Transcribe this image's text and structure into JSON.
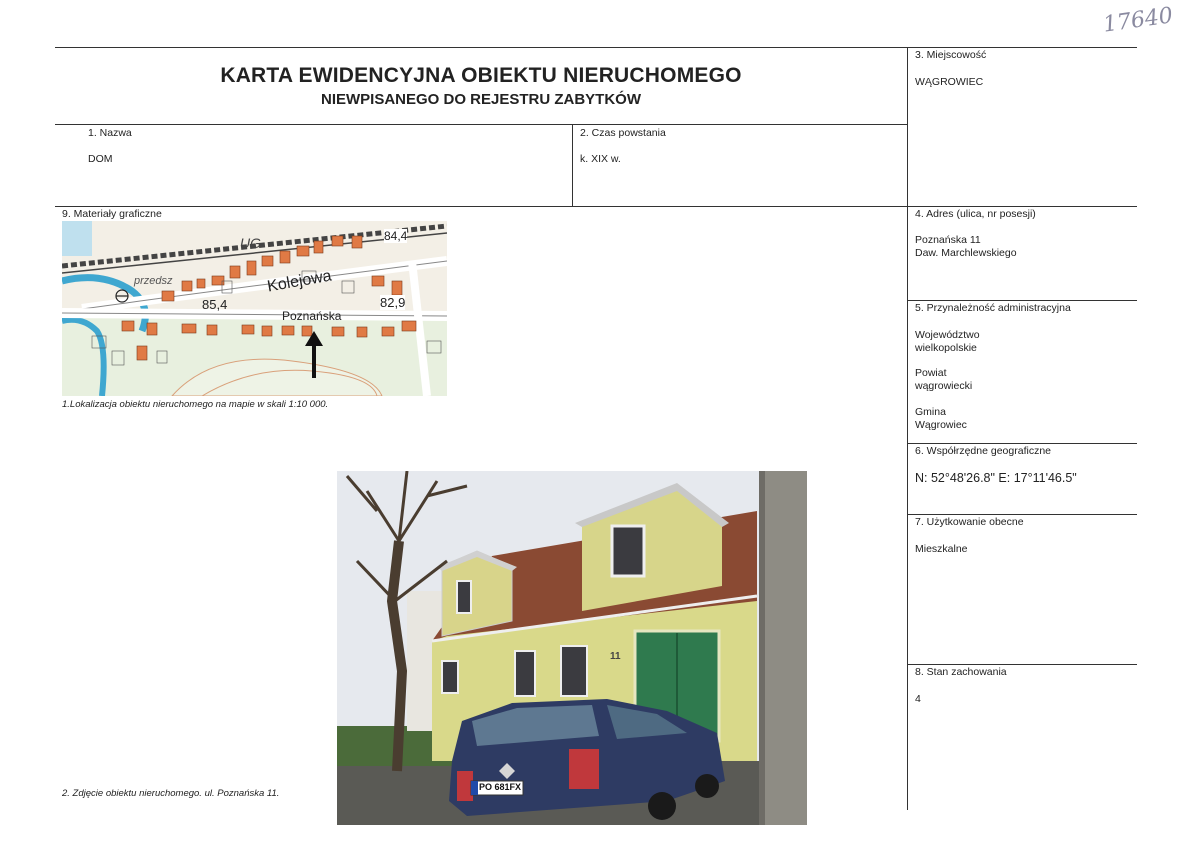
{
  "header": {
    "handwritten_number": "17640",
    "title": "KARTA EWIDENCYJNA OBIEKTU NIERUCHOMEGO",
    "subtitle": "NIEWPISANEGO DO REJESTRU ZABYTKÓW"
  },
  "fields": {
    "nazwa": {
      "label": "1.    Nazwa",
      "value": "DOM"
    },
    "czas": {
      "label": "2. Czas powstania",
      "value": "k. XIX w."
    },
    "miejscowosc": {
      "label": "3. Miejscowość",
      "value": "WĄGROWIEC"
    },
    "adres": {
      "label": "4. Adres (ulica, nr posesji)",
      "line1": "Poznańska 11",
      "line2": "Daw. Marchlewskiego"
    },
    "przynaleznosc": {
      "label": "5. Przynależność administracyjna",
      "woj_label": "Województwo",
      "woj_value": "wielkopolskie",
      "pow_label": "Powiat",
      "pow_value": "wągrowiecki",
      "gmina_label": "Gmina",
      "gmina_value": "Wągrowiec"
    },
    "wspolrzedne": {
      "label": "6. Współrzędne geograficzne",
      "value": "N: 52°48'26.8\"  E: 17°11'46.5\""
    },
    "uzytkowanie": {
      "label": "7. Użytkowanie obecne",
      "value": "Mieszkalne"
    },
    "stan": {
      "label": "8. Stan zachowania",
      "value": "4"
    },
    "materialy": {
      "label": "9. Materiały graficzne"
    }
  },
  "map": {
    "labels": [
      "UG",
      "84,4",
      "przedsz",
      "Kolejowa",
      "85,4",
      "82,9",
      "Poznańska"
    ],
    "caption": "1.Lokalizacja obiektu nieruchomego na mapie w skali 1:10 000."
  },
  "photo": {
    "caption": "2. Zdjęcie obiektu nieruchomego. ul. Poznańska 11.",
    "house_number": "11",
    "plate": "PO 681FX"
  }
}
